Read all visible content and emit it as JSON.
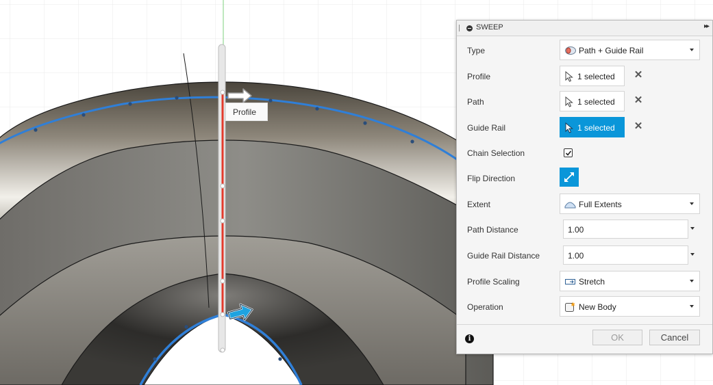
{
  "viewport": {
    "tooltip": "Profile"
  },
  "dialog": {
    "title": "SWEEP",
    "rows": {
      "type": {
        "label": "Type",
        "value": "Path + Guide Rail",
        "icon": "path-guide-rail-icon"
      },
      "profile": {
        "label": "Profile",
        "value": "1 selected",
        "active": false
      },
      "path": {
        "label": "Path",
        "value": "1 selected",
        "active": false
      },
      "guide_rail": {
        "label": "Guide Rail",
        "value": "1 selected",
        "active": true
      },
      "chain_selection": {
        "label": "Chain Selection",
        "checked": true
      },
      "flip_direction": {
        "label": "Flip Direction"
      },
      "extent": {
        "label": "Extent",
        "value": "Full Extents",
        "icon": "full-extents-icon"
      },
      "path_distance": {
        "label": "Path Distance",
        "value": "1.00"
      },
      "guide_rail_distance": {
        "label": "Guide Rail Distance",
        "value": "1.00"
      },
      "profile_scaling": {
        "label": "Profile Scaling",
        "value": "Stretch",
        "icon": "stretch-icon"
      },
      "operation": {
        "label": "Operation",
        "value": "New Body",
        "icon": "new-body-icon"
      }
    },
    "footer": {
      "ok": "OK",
      "cancel": "Cancel"
    }
  },
  "colors": {
    "accent": "#0a96d9",
    "path_curve": "#2f7fd8",
    "profile_line": "#e33a2c"
  }
}
